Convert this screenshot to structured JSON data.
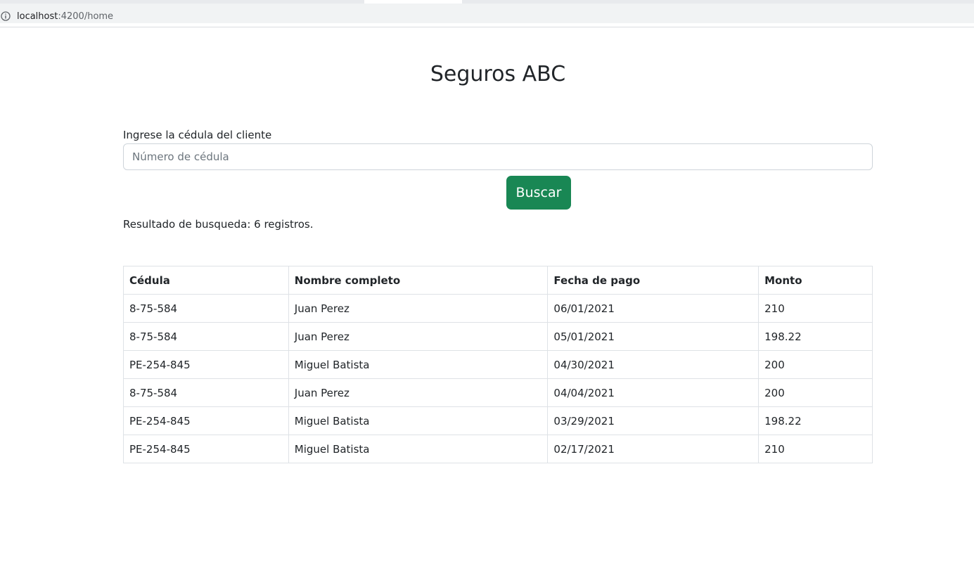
{
  "browser": {
    "url_host": "localhost",
    "url_path": ":4200/home"
  },
  "page": {
    "title": "Seguros ABC"
  },
  "search": {
    "label": "Ingrese la cédula del cliente",
    "placeholder": "Número de cédula",
    "value": "",
    "button_label": "Buscar"
  },
  "result_summary": "Resultado de busqueda: 6 registros.",
  "table": {
    "headers": [
      "Cédula",
      "Nombre completo",
      "Fecha de pago",
      "Monto"
    ],
    "rows": [
      [
        "8-75-584",
        "Juan Perez",
        "06/01/2021",
        "210"
      ],
      [
        "8-75-584",
        "Juan Perez",
        "05/01/2021",
        "198.22"
      ],
      [
        "PE-254-845",
        "Miguel Batista",
        "04/30/2021",
        "200"
      ],
      [
        "8-75-584",
        "Juan Perez",
        "04/04/2021",
        "200"
      ],
      [
        "PE-254-845",
        "Miguel Batista",
        "03/29/2021",
        "198.22"
      ],
      [
        "PE-254-845",
        "Miguel Batista",
        "02/17/2021",
        "210"
      ]
    ]
  },
  "colors": {
    "button_bg": "#198754",
    "text": "#212529",
    "border": "#dee2e6"
  },
  "icons": {
    "address_bar": "info-icon"
  }
}
